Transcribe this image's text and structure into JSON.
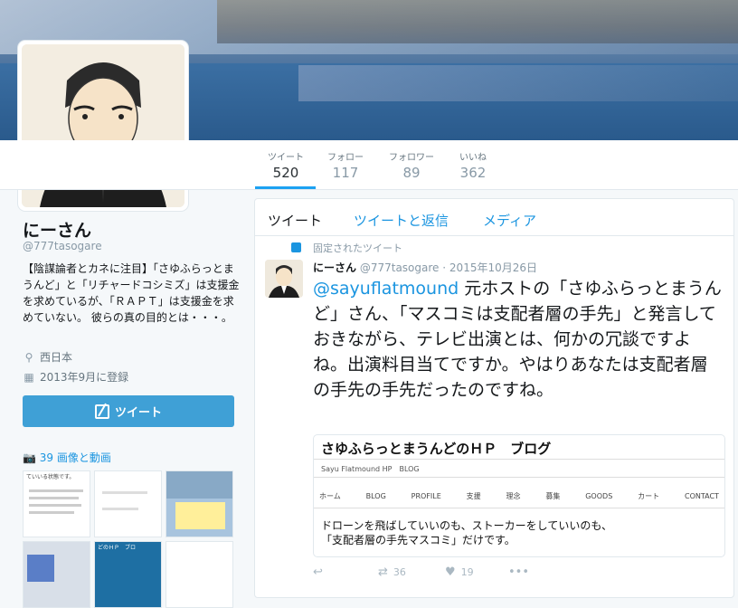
{
  "profile": {
    "name": "にーさん",
    "handle": "@777tasogare",
    "bio": "【陰謀論者とカネに注目】「さゆふらっとまうんど」と「リチャードコシミズ」は支援金を求めているが、「ＲＡＰＴ」は支援金を求めていない。 彼らの真の目的とは・・・。",
    "location": "西日本",
    "joined": "2013年9月に登録",
    "tweet_button": "ツイート",
    "media_count": "39",
    "media_label": "画像と動画"
  },
  "stats": [
    {
      "label": "ツイート",
      "value": "520"
    },
    {
      "label": "フォロー",
      "value": "117"
    },
    {
      "label": "フォロワー",
      "value": "89"
    },
    {
      "label": "いいね",
      "value": "362"
    }
  ],
  "tabs": [
    "ツイート",
    "ツイートと返信",
    "メディア"
  ],
  "tweet": {
    "pinned_label": "固定されたツイート",
    "author": "にーさん",
    "handle": "@777tasogare",
    "date": "2015年10月26日",
    "mention": "@sayuflatmound",
    "text": " 元ホストの「さゆふらっとまうんど」さん、「マスコミは支配者層の手先」と発言しておきながら、テレビ出演とは、何かの冗談ですよね。出演料目当てですか。やはりあなたは支配者層の手先の手先だったのですね。",
    "card": {
      "title": "さゆふらっとまうんどのＨＰ　ブログ",
      "subtitle": "Sayu Flatmound HP　BLOG",
      "menu": [
        "ホーム",
        "BLOG",
        "PROFILE",
        "支援",
        "理念",
        "募集",
        "GOODS",
        "カート",
        "CONTACT"
      ],
      "body_line1": "ドローンを飛ばしていいのも、ストーカーをしていいのも、",
      "body_line2": "「支配者層の手先マスコミ」だけです。"
    },
    "retweets": "36",
    "likes": "19"
  },
  "thumbnails": [
    {
      "text": "ていいる状態です。"
    },
    {
      "text": ""
    },
    {
      "text": ""
    },
    {
      "text": ""
    },
    {
      "text": "どのＨＰ　ブロ"
    },
    {
      "text": ""
    }
  ],
  "colors": {
    "accent": "#1da1f2",
    "link": "#1b95e0",
    "button": "#3fa0d6"
  }
}
